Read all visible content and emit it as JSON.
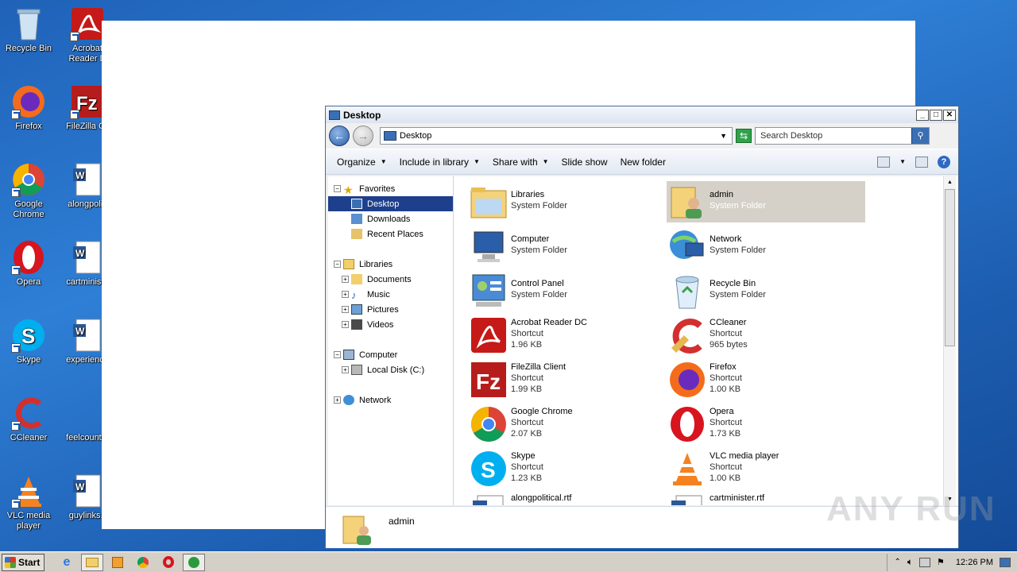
{
  "desktop": {
    "icons": [
      {
        "label": "Recycle Bin",
        "icon": "recycle-bin-icon"
      },
      {
        "label": "Acrobat Reader D",
        "icon": "acrobat-icon"
      },
      {
        "label": "Firefox",
        "icon": "firefox-icon"
      },
      {
        "label": "FileZilla Cli",
        "icon": "filezilla-icon"
      },
      {
        "label": "Google Chrome",
        "icon": "chrome-icon"
      },
      {
        "label": "alongpoliti",
        "icon": "word-doc-icon"
      },
      {
        "label": "Opera",
        "icon": "opera-icon"
      },
      {
        "label": "cartministe",
        "icon": "word-doc-icon"
      },
      {
        "label": "Skype",
        "icon": "skype-icon"
      },
      {
        "label": "experience",
        "icon": "word-doc-icon"
      },
      {
        "label": "CCleaner",
        "icon": "ccleaner-icon"
      },
      {
        "label": "feelcountry",
        "icon": "word-doc-icon"
      },
      {
        "label": "VLC media player",
        "icon": "vlc-icon"
      },
      {
        "label": "guylinks.r",
        "icon": "word-doc-icon"
      }
    ]
  },
  "window": {
    "title": "Desktop",
    "address": "Desktop",
    "search_placeholder": "Search Desktop",
    "toolbar": {
      "organize": "Organize",
      "include_in_library": "Include in library",
      "share_with": "Share with",
      "slide_show": "Slide show",
      "new_folder": "New folder"
    },
    "nav": {
      "favorites": "Favorites",
      "desktop": "Desktop",
      "downloads": "Downloads",
      "recent_places": "Recent Places",
      "libraries": "Libraries",
      "documents": "Documents",
      "music": "Music",
      "pictures": "Pictures",
      "videos": "Videos",
      "computer": "Computer",
      "local_disk": "Local Disk (C:)",
      "network": "Network"
    },
    "items": [
      {
        "name": "Libraries",
        "type": "System Folder",
        "size": "",
        "icon": "libraries-folder-icon"
      },
      {
        "name": "admin",
        "type": "System Folder",
        "size": "",
        "icon": "user-folder-icon"
      },
      {
        "name": "Computer",
        "type": "System Folder",
        "size": "",
        "icon": "computer-icon"
      },
      {
        "name": "Network",
        "type": "System Folder",
        "size": "",
        "icon": "network-icon"
      },
      {
        "name": "Control Panel",
        "type": "System Folder",
        "size": "",
        "icon": "control-panel-icon"
      },
      {
        "name": "Recycle Bin",
        "type": "System Folder",
        "size": "",
        "icon": "recycle-bin-icon"
      },
      {
        "name": "Acrobat Reader DC",
        "type": "Shortcut",
        "size": "1.96 KB",
        "icon": "acrobat-icon"
      },
      {
        "name": "CCleaner",
        "type": "Shortcut",
        "size": "965 bytes",
        "icon": "ccleaner-icon"
      },
      {
        "name": "FileZilla Client",
        "type": "Shortcut",
        "size": "1.99 KB",
        "icon": "filezilla-icon"
      },
      {
        "name": "Firefox",
        "type": "Shortcut",
        "size": "1.00 KB",
        "icon": "firefox-icon"
      },
      {
        "name": "Google Chrome",
        "type": "Shortcut",
        "size": "2.07 KB",
        "icon": "chrome-icon"
      },
      {
        "name": "Opera",
        "type": "Shortcut",
        "size": "1.73 KB",
        "icon": "opera-icon"
      },
      {
        "name": "Skype",
        "type": "Shortcut",
        "size": "1.23 KB",
        "icon": "skype-icon"
      },
      {
        "name": "VLC media player",
        "type": "Shortcut",
        "size": "1.00 KB",
        "icon": "vlc-icon"
      },
      {
        "name": "alongpolitical.rtf",
        "type": "",
        "size": "",
        "icon": "word-doc-icon"
      },
      {
        "name": "cartminister.rtf",
        "type": "",
        "size": "",
        "icon": "word-doc-icon"
      }
    ],
    "details_name": "admin"
  },
  "taskbar": {
    "start": "Start",
    "clock": "12:26 PM"
  },
  "watermark": "ANY RUN"
}
